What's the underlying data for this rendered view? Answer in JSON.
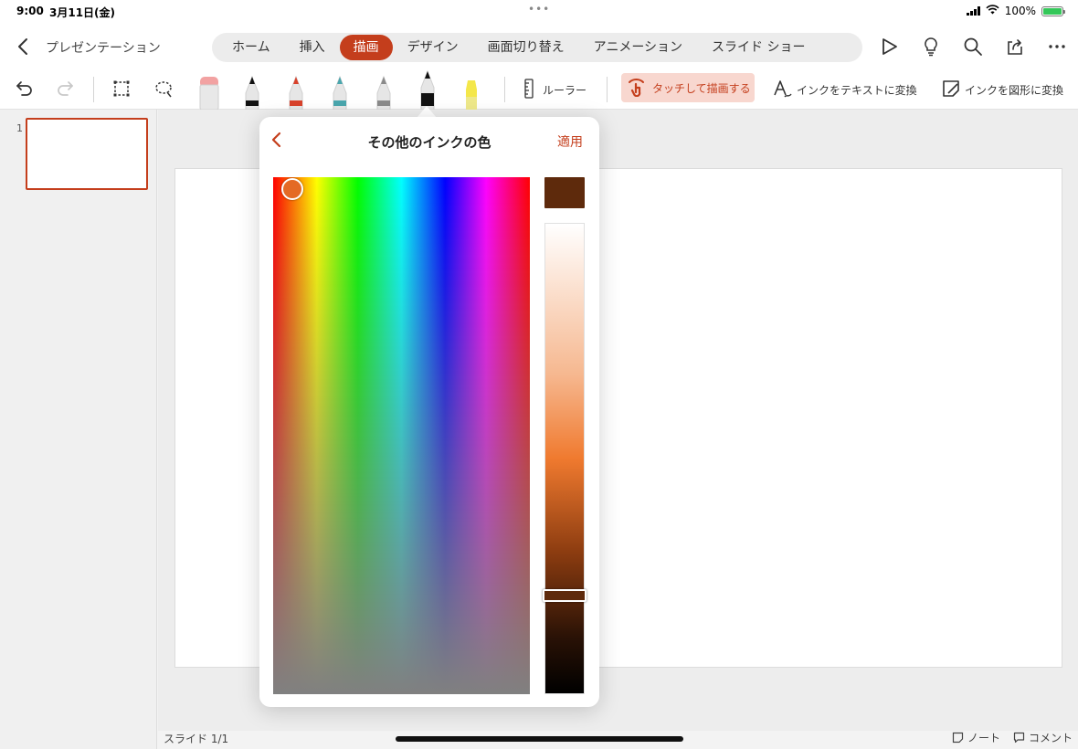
{
  "status_bar": {
    "time": "9:00",
    "date": "3月11日(金)",
    "battery": "100%"
  },
  "header": {
    "doc_title": "プレゼンテーション",
    "tabs": [
      {
        "label": "ホーム"
      },
      {
        "label": "挿入"
      },
      {
        "label": "描画",
        "active": true
      },
      {
        "label": "デザイン"
      },
      {
        "label": "画面切り替え"
      },
      {
        "label": "アニメーション"
      },
      {
        "label": "スライド ショー"
      }
    ],
    "icons": [
      "play-icon",
      "lightbulb-icon",
      "search-icon",
      "share-icon",
      "more-icon"
    ]
  },
  "toolbar": {
    "ruler_label": "ルーラー",
    "touch_draw_label": "タッチして描画する",
    "ink_to_text_label": "インクをテキストに変換",
    "ink_to_shape_label": "インクを図形に変換",
    "pens": [
      {
        "name": "eraser",
        "color": "#f2a2a2"
      },
      {
        "name": "pen-black",
        "color": "#111111"
      },
      {
        "name": "pen-red",
        "color": "#d8422c"
      },
      {
        "name": "pen-teal",
        "color": "#4aa6ad"
      },
      {
        "name": "pen-gray",
        "color": "#8a8a8a"
      },
      {
        "name": "pencil-black",
        "color": "#111111",
        "selected": true
      },
      {
        "name": "highlighter-yellow",
        "color": "#f4e74a"
      }
    ]
  },
  "thumbnails": {
    "items": [
      {
        "number": "1"
      }
    ]
  },
  "popover": {
    "title": "その他のインクの色",
    "apply_label": "適用",
    "selected_color": "#5e2a0c"
  },
  "footer": {
    "slide_count": "スライド 1/1",
    "notes_label": "ノート",
    "comments_label": "コメント"
  },
  "colors": {
    "accent": "#c43e1c",
    "accent_light": "#f8d7cf"
  }
}
